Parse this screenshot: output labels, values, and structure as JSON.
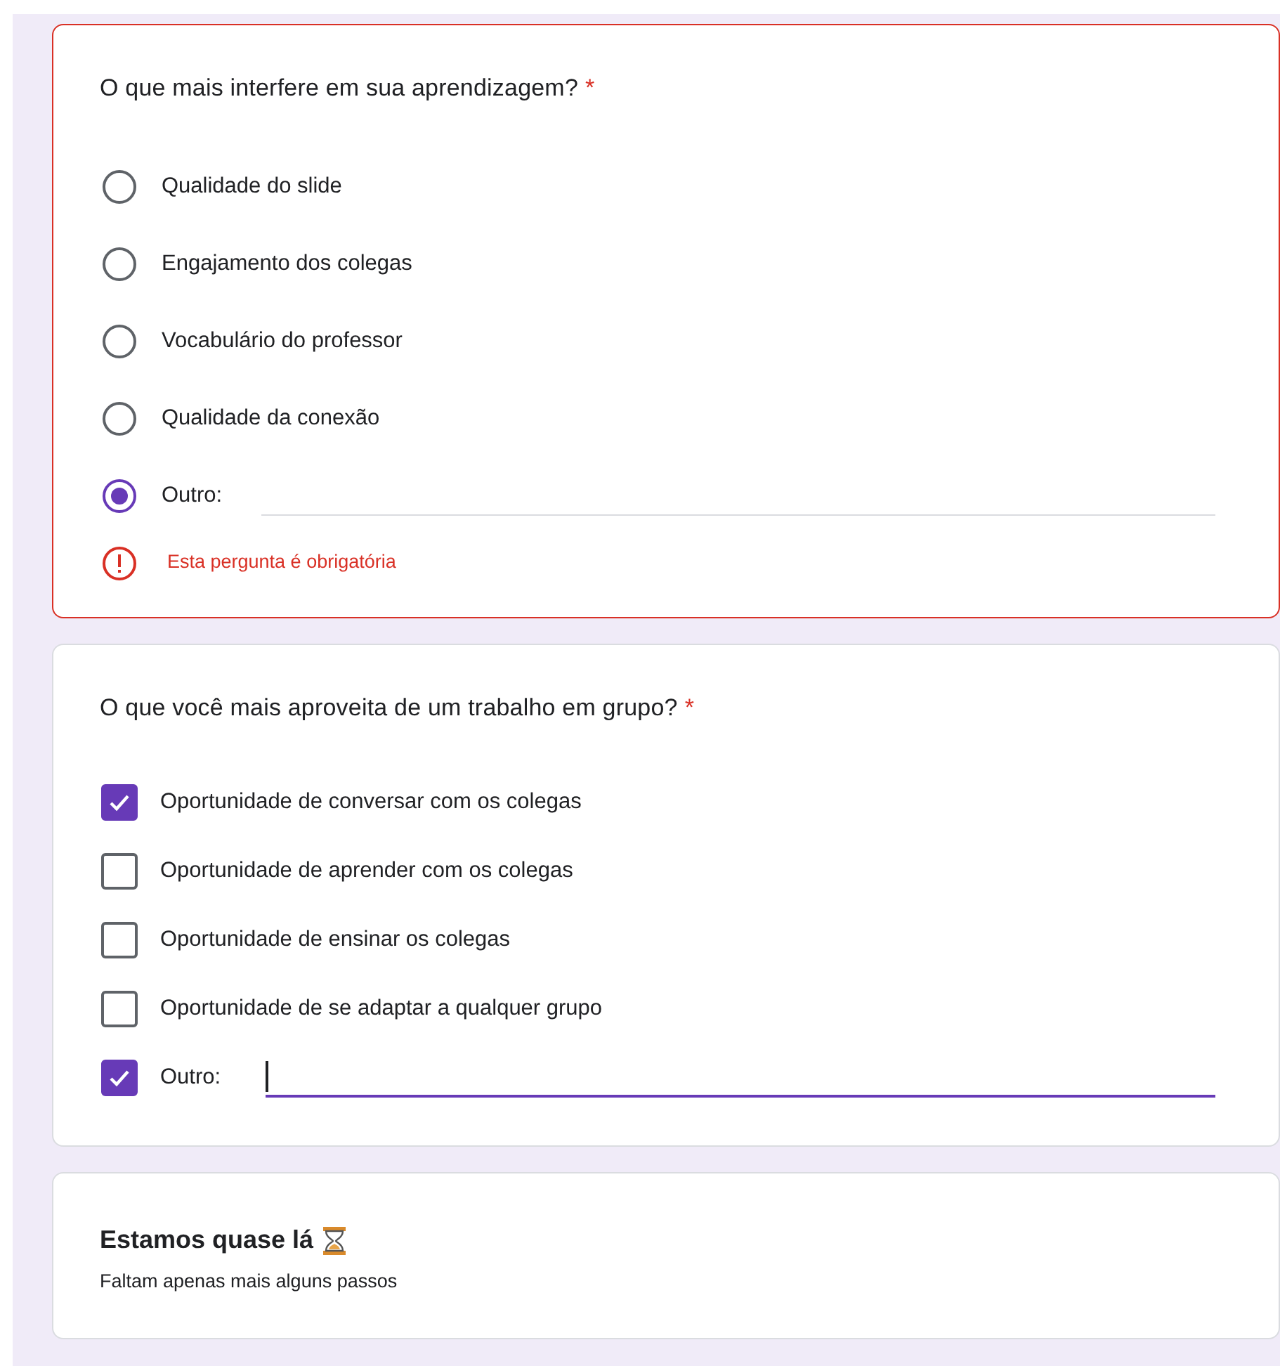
{
  "questions": [
    {
      "kind": "radio",
      "title": "O que mais interfere em sua aprendizagem?",
      "required_mark": "*",
      "error": "Esta pergunta é obrigatória",
      "options": [
        {
          "label": "Qualidade do slide",
          "selected": false
        },
        {
          "label": "Engajamento dos colegas",
          "selected": false
        },
        {
          "label": "Vocabulário do professor",
          "selected": false
        },
        {
          "label": "Qualidade da conexão",
          "selected": false
        },
        {
          "label": "Outro:",
          "selected": true,
          "kind": "other",
          "focused": false
        }
      ]
    },
    {
      "kind": "checkbox",
      "title": "O que você mais aproveita de um trabalho em grupo?",
      "required_mark": "*",
      "options": [
        {
          "label": "Oportunidade de conversar com os colegas",
          "checked": true
        },
        {
          "label": "Oportunidade de aprender com os colegas",
          "checked": false
        },
        {
          "label": "Oportunidade de ensinar os colegas",
          "checked": false
        },
        {
          "label": "Oportunidade de se adaptar a qualquer grupo",
          "checked": false
        },
        {
          "label": "Outro:",
          "checked": true,
          "kind": "other",
          "focused": true
        }
      ]
    }
  ],
  "section": {
    "title": "Estamos quase lá",
    "subtitle": "Faltam apenas mais alguns passos"
  }
}
